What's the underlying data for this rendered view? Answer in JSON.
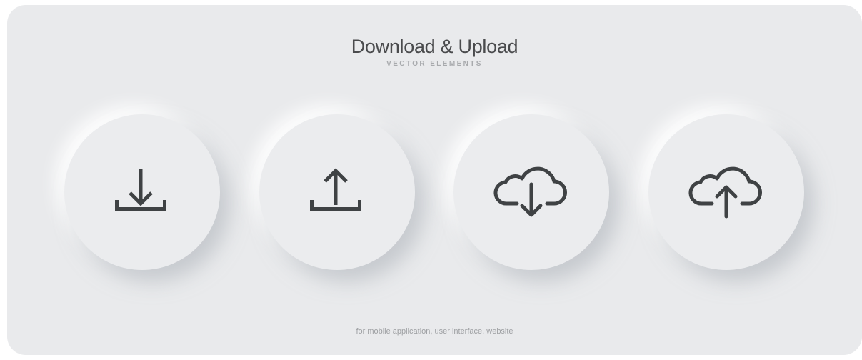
{
  "header": {
    "title": "Download & Upload",
    "subtitle": "VECTOR ELEMENTS"
  },
  "buttons": [
    {
      "icon": "download-icon"
    },
    {
      "icon": "upload-icon"
    },
    {
      "icon": "cloud-download-icon"
    },
    {
      "icon": "cloud-upload-icon"
    }
  ],
  "footer": {
    "text": "for mobile application, user interface, website"
  },
  "colors": {
    "background": "#e9eaec",
    "icon": "#3f4244",
    "title": "#4a4b4d",
    "muted_text": "#a8aaad"
  }
}
